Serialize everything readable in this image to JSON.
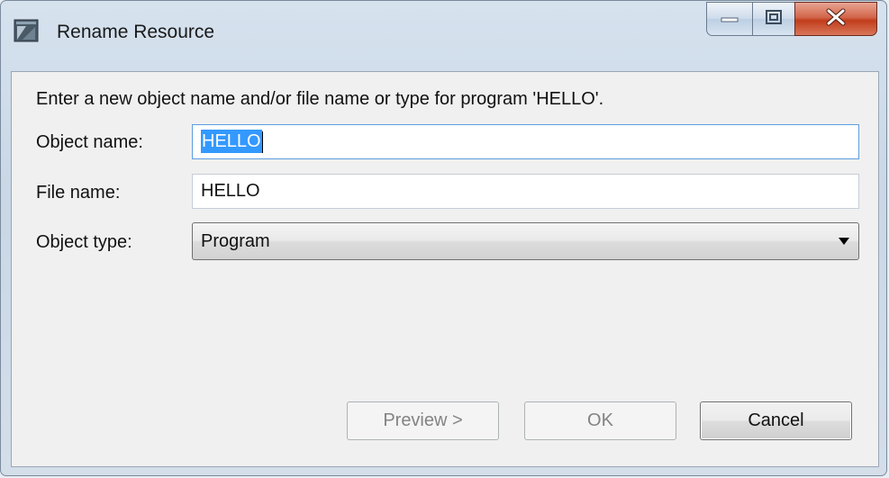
{
  "window": {
    "title": "Rename Resource",
    "icon": "rename-resource-app-icon"
  },
  "title_controls": {
    "minimize": "minimize-icon",
    "maximize": "maximize-icon",
    "close": "close-icon"
  },
  "form": {
    "instruction": "Enter a new object name and/or file name or type for program 'HELLO'.",
    "object_name_label": "Object name:",
    "object_name_value": "HELLO",
    "file_name_label": "File name:",
    "file_name_value": "HELLO",
    "object_type_label": "Object type:",
    "object_type_value": "Program"
  },
  "buttons": {
    "preview": "Preview >",
    "ok": "OK",
    "cancel": "Cancel"
  },
  "colors": {
    "selection": "#3399ff",
    "close_button": "#c13d1c",
    "focus_border": "#5f9ede"
  }
}
